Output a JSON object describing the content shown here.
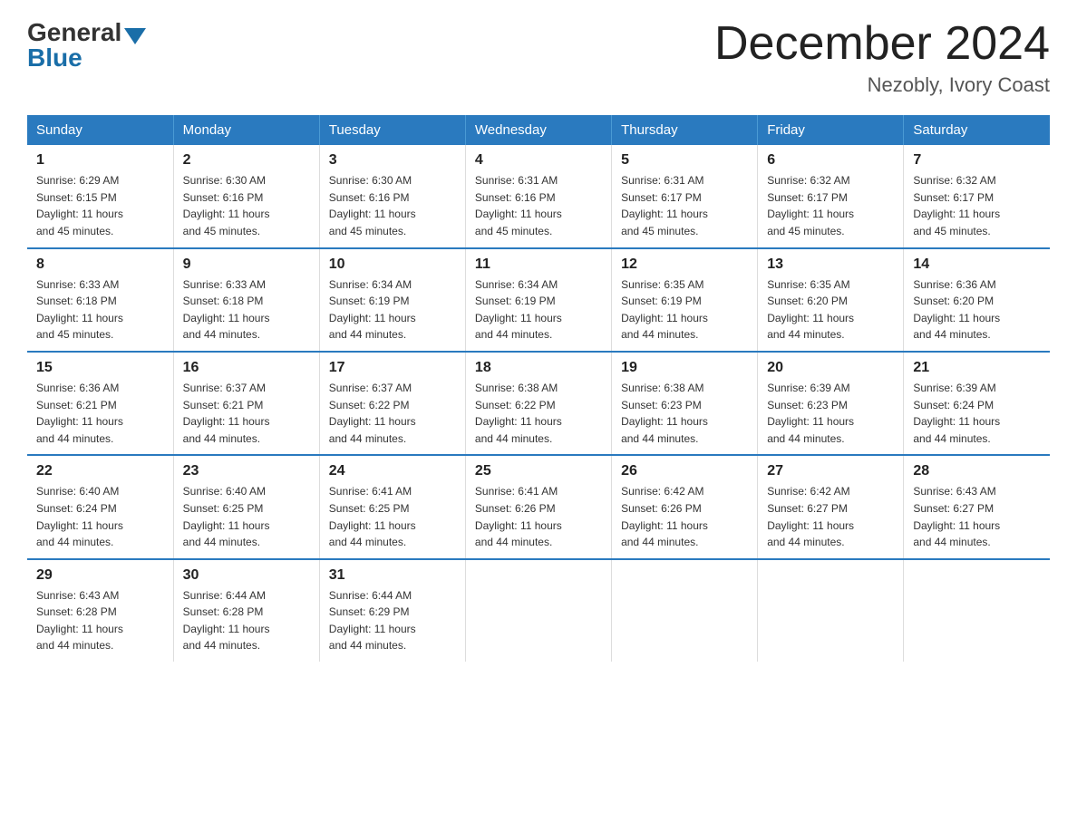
{
  "header": {
    "logo_general": "General",
    "logo_blue": "Blue",
    "month_title": "December 2024",
    "location": "Nezobly, Ivory Coast"
  },
  "days_of_week": [
    "Sunday",
    "Monday",
    "Tuesday",
    "Wednesday",
    "Thursday",
    "Friday",
    "Saturday"
  ],
  "weeks": [
    [
      {
        "day": "1",
        "sunrise": "6:29 AM",
        "sunset": "6:15 PM",
        "daylight": "11 hours and 45 minutes."
      },
      {
        "day": "2",
        "sunrise": "6:30 AM",
        "sunset": "6:16 PM",
        "daylight": "11 hours and 45 minutes."
      },
      {
        "day": "3",
        "sunrise": "6:30 AM",
        "sunset": "6:16 PM",
        "daylight": "11 hours and 45 minutes."
      },
      {
        "day": "4",
        "sunrise": "6:31 AM",
        "sunset": "6:16 PM",
        "daylight": "11 hours and 45 minutes."
      },
      {
        "day": "5",
        "sunrise": "6:31 AM",
        "sunset": "6:17 PM",
        "daylight": "11 hours and 45 minutes."
      },
      {
        "day": "6",
        "sunrise": "6:32 AM",
        "sunset": "6:17 PM",
        "daylight": "11 hours and 45 minutes."
      },
      {
        "day": "7",
        "sunrise": "6:32 AM",
        "sunset": "6:17 PM",
        "daylight": "11 hours and 45 minutes."
      }
    ],
    [
      {
        "day": "8",
        "sunrise": "6:33 AM",
        "sunset": "6:18 PM",
        "daylight": "11 hours and 45 minutes."
      },
      {
        "day": "9",
        "sunrise": "6:33 AM",
        "sunset": "6:18 PM",
        "daylight": "11 hours and 44 minutes."
      },
      {
        "day": "10",
        "sunrise": "6:34 AM",
        "sunset": "6:19 PM",
        "daylight": "11 hours and 44 minutes."
      },
      {
        "day": "11",
        "sunrise": "6:34 AM",
        "sunset": "6:19 PM",
        "daylight": "11 hours and 44 minutes."
      },
      {
        "day": "12",
        "sunrise": "6:35 AM",
        "sunset": "6:19 PM",
        "daylight": "11 hours and 44 minutes."
      },
      {
        "day": "13",
        "sunrise": "6:35 AM",
        "sunset": "6:20 PM",
        "daylight": "11 hours and 44 minutes."
      },
      {
        "day": "14",
        "sunrise": "6:36 AM",
        "sunset": "6:20 PM",
        "daylight": "11 hours and 44 minutes."
      }
    ],
    [
      {
        "day": "15",
        "sunrise": "6:36 AM",
        "sunset": "6:21 PM",
        "daylight": "11 hours and 44 minutes."
      },
      {
        "day": "16",
        "sunrise": "6:37 AM",
        "sunset": "6:21 PM",
        "daylight": "11 hours and 44 minutes."
      },
      {
        "day": "17",
        "sunrise": "6:37 AM",
        "sunset": "6:22 PM",
        "daylight": "11 hours and 44 minutes."
      },
      {
        "day": "18",
        "sunrise": "6:38 AM",
        "sunset": "6:22 PM",
        "daylight": "11 hours and 44 minutes."
      },
      {
        "day": "19",
        "sunrise": "6:38 AM",
        "sunset": "6:23 PM",
        "daylight": "11 hours and 44 minutes."
      },
      {
        "day": "20",
        "sunrise": "6:39 AM",
        "sunset": "6:23 PM",
        "daylight": "11 hours and 44 minutes."
      },
      {
        "day": "21",
        "sunrise": "6:39 AM",
        "sunset": "6:24 PM",
        "daylight": "11 hours and 44 minutes."
      }
    ],
    [
      {
        "day": "22",
        "sunrise": "6:40 AM",
        "sunset": "6:24 PM",
        "daylight": "11 hours and 44 minutes."
      },
      {
        "day": "23",
        "sunrise": "6:40 AM",
        "sunset": "6:25 PM",
        "daylight": "11 hours and 44 minutes."
      },
      {
        "day": "24",
        "sunrise": "6:41 AM",
        "sunset": "6:25 PM",
        "daylight": "11 hours and 44 minutes."
      },
      {
        "day": "25",
        "sunrise": "6:41 AM",
        "sunset": "6:26 PM",
        "daylight": "11 hours and 44 minutes."
      },
      {
        "day": "26",
        "sunrise": "6:42 AM",
        "sunset": "6:26 PM",
        "daylight": "11 hours and 44 minutes."
      },
      {
        "day": "27",
        "sunrise": "6:42 AM",
        "sunset": "6:27 PM",
        "daylight": "11 hours and 44 minutes."
      },
      {
        "day": "28",
        "sunrise": "6:43 AM",
        "sunset": "6:27 PM",
        "daylight": "11 hours and 44 minutes."
      }
    ],
    [
      {
        "day": "29",
        "sunrise": "6:43 AM",
        "sunset": "6:28 PM",
        "daylight": "11 hours and 44 minutes."
      },
      {
        "day": "30",
        "sunrise": "6:44 AM",
        "sunset": "6:28 PM",
        "daylight": "11 hours and 44 minutes."
      },
      {
        "day": "31",
        "sunrise": "6:44 AM",
        "sunset": "6:29 PM",
        "daylight": "11 hours and 44 minutes."
      },
      null,
      null,
      null,
      null
    ]
  ],
  "labels": {
    "sunrise": "Sunrise:",
    "sunset": "Sunset:",
    "daylight": "Daylight:"
  }
}
